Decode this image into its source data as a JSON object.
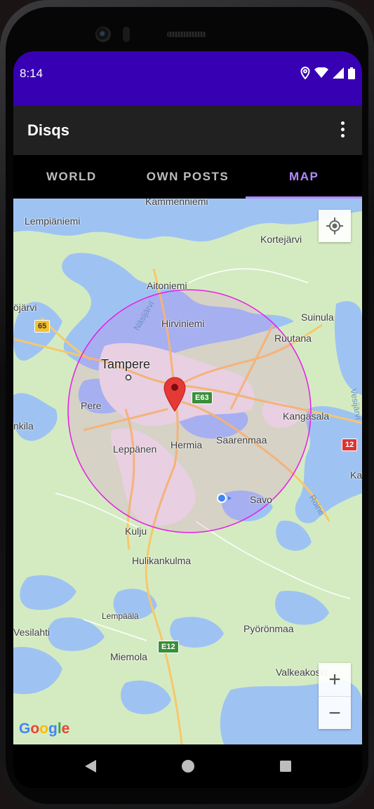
{
  "status_bar": {
    "time": "8:14"
  },
  "app_bar": {
    "title": "Disqs"
  },
  "tabs": [
    {
      "label": "WORLD",
      "active": false
    },
    {
      "label": "OWN POSTS",
      "active": false
    },
    {
      "label": "MAP",
      "active": true
    }
  ],
  "colors": {
    "status_bar": "#3700b3",
    "app_bar": "#212121",
    "tab_active": "#b388ff",
    "radius_circle": "#e61ee6",
    "marker": "#e53935"
  },
  "map": {
    "labels": {
      "kammenniemi": "Kammenniemi",
      "lempiaaniemi": "Lempiäniemi",
      "kortejarvi": "Kortejärvi",
      "aitoniemi": "Aitoniemi",
      "ojarvi": "öjärvi",
      "nasijarvi": "Näsijärvi",
      "hirviniemi": "Hirviniemi",
      "suinula": "Suinula",
      "ruutana": "Ruutana",
      "tampere": "Tampere",
      "pere": "Pere",
      "nkila": "nkila",
      "kangasala": "Kangasala",
      "vesijarvi": "Vesijärvi",
      "leppanen": "Leppänen",
      "hermia": "Hermia",
      "saarenmaa": "Saarenmaa",
      "ka": "Ka",
      "roine": "Roine",
      "savo": "Savo",
      "kulju": "Kulju",
      "hulikankulma": "Hulikankulma",
      "lempaala": "Lempäälä",
      "vesilahti": "Vesilahti",
      "pyoronmaa": "Pyörönmaa",
      "miemola": "Miemola",
      "valkeakoski": "Valkeakoski"
    },
    "road_shields": {
      "r65": "65",
      "e63": "E63",
      "r12": "12",
      "e12": "E12"
    },
    "zoom_in": "+",
    "zoom_out": "−",
    "attribution": "Google"
  },
  "nav": {
    "back": "back-icon",
    "home": "home-icon",
    "recents": "recents-icon"
  }
}
